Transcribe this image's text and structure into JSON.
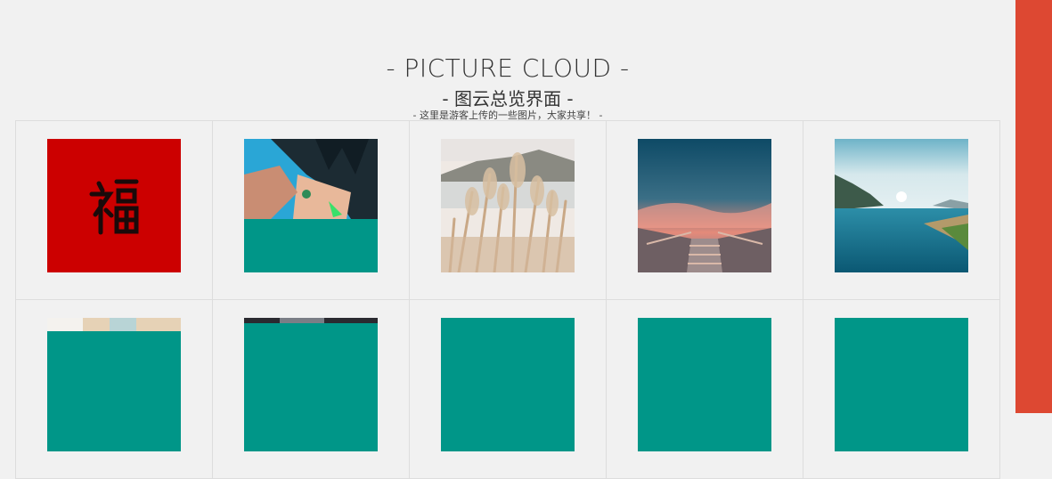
{
  "header": {
    "title": "- PICTURE CLOUD -",
    "subtitle": "- 图云总览界面 -",
    "tagline": "- 这里是游客上传的一些图片，大家共享！ -"
  },
  "gallery": {
    "placeholder_color": "#009688",
    "items": [
      {
        "name": "fu-character-picture"
      },
      {
        "name": "anime-girl-picture"
      },
      {
        "name": "reed-grass-lake-picture"
      },
      {
        "name": "sunset-stairs-picture"
      },
      {
        "name": "mountain-lake-picture"
      },
      {
        "name": "loading-picture-1"
      },
      {
        "name": "loading-picture-2"
      },
      {
        "name": "loading-picture-3"
      },
      {
        "name": "loading-picture-4"
      },
      {
        "name": "loading-picture-5"
      }
    ]
  },
  "colors": {
    "accent_bar": "#dd4832",
    "background": "#f1f1f1"
  }
}
